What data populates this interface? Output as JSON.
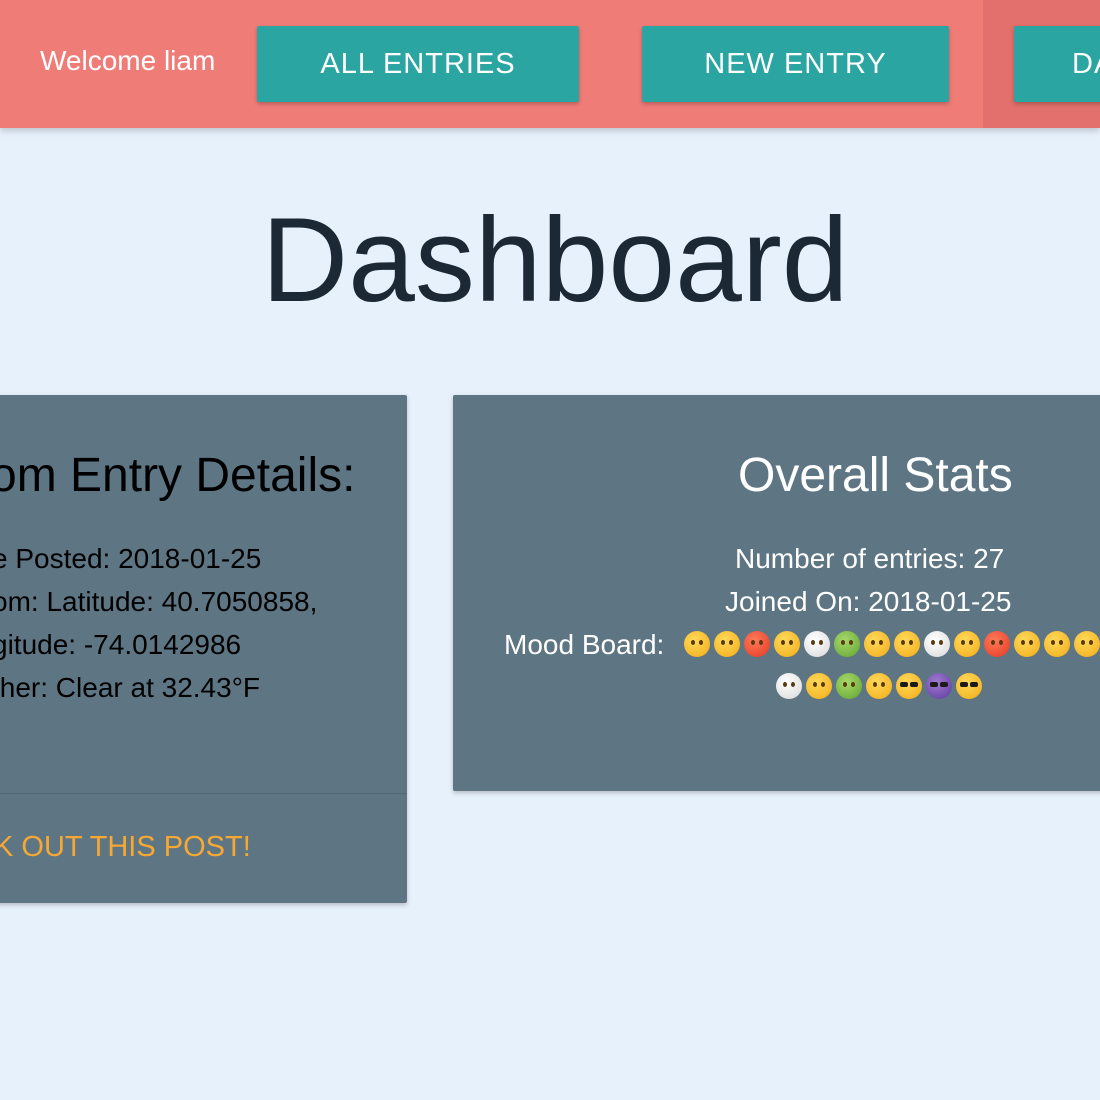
{
  "nav": {
    "welcome": "Welcome liam",
    "buttons": {
      "all_entries": "ALL ENTRIES",
      "new_entry": "NEW ENTRY",
      "dashboard_partial": "DA"
    }
  },
  "page_title": "Dashboard",
  "random_entry": {
    "title": "om Entry Details:",
    "lines": [
      "e Posted: 2018-01-25",
      "om: Latitude: 40.7050858,",
      "gitude: -74.0142986",
      "ther: Clear at 32.43°F"
    ],
    "action": "K OUT THIS POST!"
  },
  "overall_stats": {
    "title": "Overall Stats",
    "number_of_entries": "Number of entries: 27",
    "joined_on": "Joined On: 2018-01-25",
    "mood_board_label": "Mood Board:",
    "moods_row1": [
      "neutral",
      "nerd",
      "devil-red",
      "astonished",
      "clown",
      "money-mouth",
      "grin",
      "hushed",
      "grimace",
      "tongue",
      "angry-red",
      "tongue",
      "hug",
      "rofl"
    ],
    "moods_row2": [
      "clown",
      "flushed",
      "nauseated-green",
      "cry",
      "sunglasses",
      "imp-purple",
      "sunglasses"
    ]
  },
  "colors": {
    "nav_bg": "#f07c78",
    "button_bg": "#2aa5a1",
    "page_bg": "#e7f1fb",
    "card_bg": "#5e7684",
    "action_text": "#f7a833",
    "title_text": "#1c2833"
  }
}
